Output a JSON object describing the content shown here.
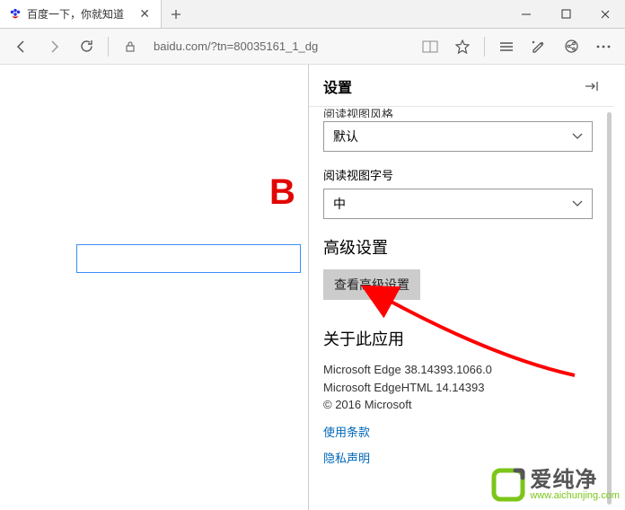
{
  "tab": {
    "title": "百度一下，你就知道"
  },
  "url": "baidu.com/?tn=80035161_1_dg",
  "page": {
    "logo_fragment": "B"
  },
  "settings": {
    "title": "设置",
    "reading_view_style_label": "阅读视图风格",
    "reading_view_style_value": "默认",
    "reading_view_font_label": "阅读视图字号",
    "reading_view_font_value": "中",
    "advanced_title": "高级设置",
    "advanced_button": "查看高级设置",
    "about_title": "关于此应用",
    "about_line1": "Microsoft Edge 38.14393.1066.0",
    "about_line2": "Microsoft EdgeHTML 14.14393",
    "about_line3": "© 2016 Microsoft",
    "terms_link": "使用条款",
    "privacy_link": "隐私声明"
  },
  "watermark": {
    "cn": "爱纯净",
    "en": "www.aichunjing.com"
  }
}
